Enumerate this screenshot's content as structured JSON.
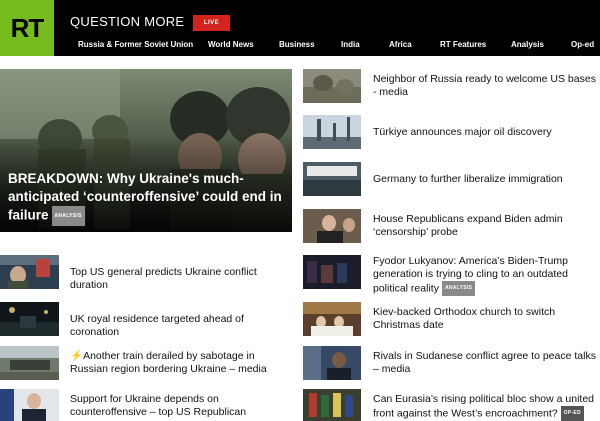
{
  "header": {
    "logo": "RT",
    "tagline": "QUESTION MORE",
    "live_label": "LIVE",
    "nav": [
      "Russia & Former Soviet Union",
      "World News",
      "Business",
      "India",
      "Africa",
      "RT Features",
      "Analysis",
      "Op-ed"
    ]
  },
  "hero": {
    "title": "BREAKDOWN: Why Ukraine's much-anticipated ‘counteroffensive’ could end in failure",
    "badge": "ANALYSIS"
  },
  "left_stories": [
    {
      "title": "Top US general predicts Ukraine conflict duration"
    },
    {
      "title": "UK royal residence targeted ahead of coronation"
    },
    {
      "title": "Another train derailed by sabotage in Russian region bordering Ukraine – media",
      "breaking_icon": "lightning-icon"
    },
    {
      "title": "Support for Ukraine depends on counteroffensive – top US Republican"
    }
  ],
  "right_stories": [
    {
      "title": "Neighbor of Russia ready to welcome US bases - media"
    },
    {
      "title": "Türkiye announces major oil discovery"
    },
    {
      "title": "Germany to further liberalize immigration"
    },
    {
      "title": "House Republicans expand Biden admin ‘censorship’ probe"
    },
    {
      "title": "Fyodor Lukyanov: America’s Biden-Trump generation is trying to cling to an outdated political reality",
      "badge": "ANALYSIS"
    },
    {
      "title": "Kiev-backed Orthodox church to switch Christmas date"
    },
    {
      "title": "Rivals in Sudanese conflict agree to peace talks – media"
    },
    {
      "title": "Can Eurasia’s rising political bloc show a united front against the West’s encroachment?",
      "badge": "OP-ED"
    }
  ],
  "colors": {
    "brand_green": "#77bc1f",
    "live_red": "#d3231f",
    "header_bg": "#000000"
  }
}
